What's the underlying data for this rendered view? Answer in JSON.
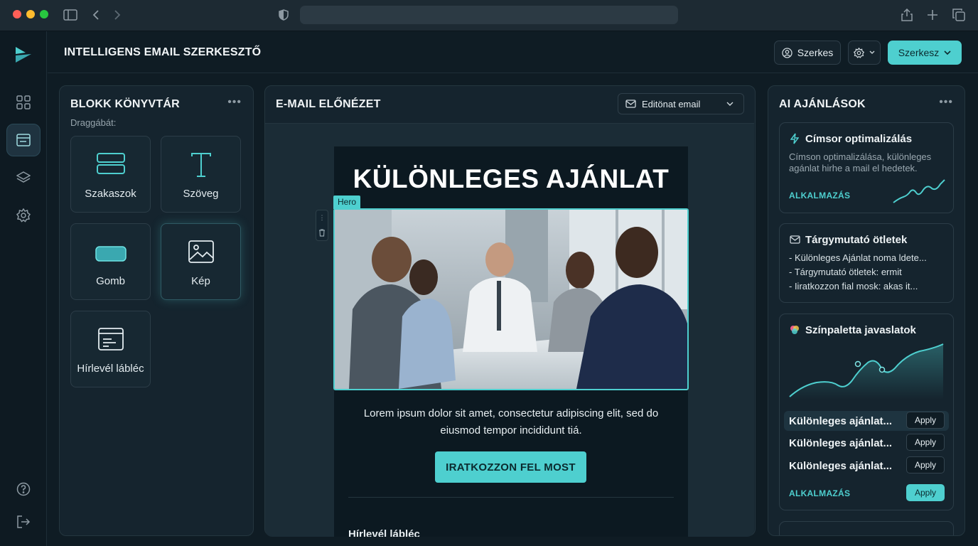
{
  "app": {
    "title": "INTELLIGENS EMAIL SZERKESZTŐ",
    "user_button": "Szerkes",
    "primary_button": "Szerkesz"
  },
  "library": {
    "title": "BLOKK KÖNYVTÁR",
    "drag_label": "Draggábát:",
    "blocks": [
      {
        "label": "Szakaszok",
        "icon": "sections-icon"
      },
      {
        "label": "Szöveg",
        "icon": "text-icon"
      },
      {
        "label": "Gomb",
        "icon": "button-icon"
      },
      {
        "label": "Kép",
        "icon": "image-icon"
      },
      {
        "label": "Hírlevél lábléc",
        "icon": "footer-icon"
      }
    ]
  },
  "preview": {
    "title": "E-MAIL ELŐNÉZET",
    "select_value": "Editönat email",
    "headline": "KÜLÖNLEGES AJÁNLAT",
    "hero_tag": "Hero",
    "body": "Lorem ipsum dolor sit amet, consectetur adipiscing elit, sed do eiusmod tempor incididunt tiá.",
    "cta": "IRATKOZZON FEL MOST",
    "footer_title": "Hírlevél lábléc"
  },
  "ai": {
    "title": "AI AJÁNLÁSOK",
    "card1": {
      "title": "Címsor optimalizálás",
      "text": "Címson optimalizálása, különleges agánlat hirhe a mail el hedetek.",
      "link": "ALKALMAZÁS"
    },
    "card2": {
      "title": "Tárgymutató ötletek",
      "items": [
        "-  Különleges Ajánlat noma ldete...",
        "- Tárgymutató ötletek: ermit",
        "- Iiratkozzon fial mosk: akas it..."
      ]
    },
    "card3": {
      "title": "Színpaletta javaslatok",
      "suggestions": [
        "Különleges ajánlat...",
        "Különleges ajánlat...",
        "Különleges ajánlat..."
      ],
      "apply": "Apply",
      "link": "ALKALMAZÁS"
    }
  },
  "colors": {
    "accent": "#4ecfcf",
    "background": "#0f1c24",
    "panel": "#15242e"
  }
}
